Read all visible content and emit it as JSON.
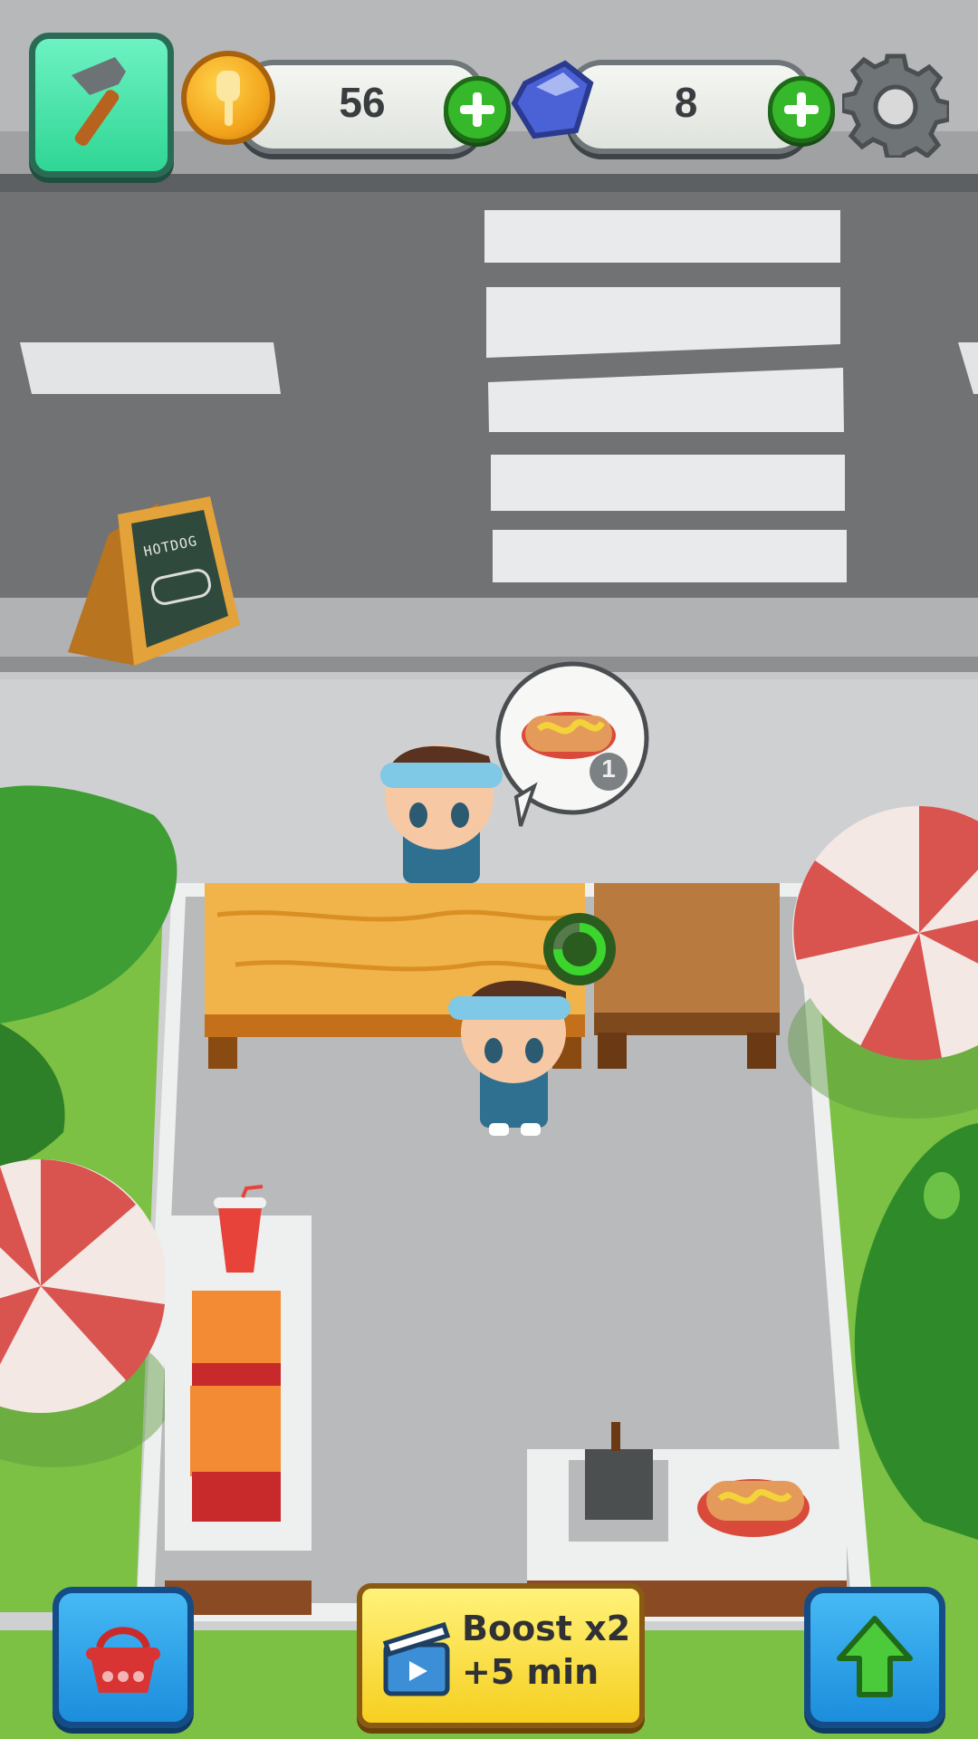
{
  "hud": {
    "build_button_icon": "hammer-icon",
    "coins": {
      "icon": "coin-spatula-icon",
      "value": "56",
      "add_icon": "plus-icon"
    },
    "gems": {
      "icon": "blue-gem-icon",
      "value": "8",
      "add_icon": "plus-icon"
    },
    "settings_icon": "gear-icon"
  },
  "street_sign": {
    "text": "HOTDOG",
    "icon": "hotdog-drawing-icon"
  },
  "customer_order": {
    "item_icon": "hotdog-icon",
    "quantity": "1"
  },
  "bottom_bar": {
    "shop_icon": "basket-icon",
    "boost": {
      "icon": "video-clapper-icon",
      "line1": "Boost x2",
      "line2": "+5 min"
    },
    "upgrade_icon": "up-arrow-icon"
  },
  "colors": {
    "road": "#707274",
    "sidewalk": "#a9abad",
    "plaza": "#cfd0d1",
    "grass": "#7cc044",
    "coin": "#f2a31b",
    "gem": "#4a62d6",
    "build_btn": "#39e0a2",
    "blue_btn": "#1c9be8",
    "boost_btn": "#f9e24a"
  }
}
